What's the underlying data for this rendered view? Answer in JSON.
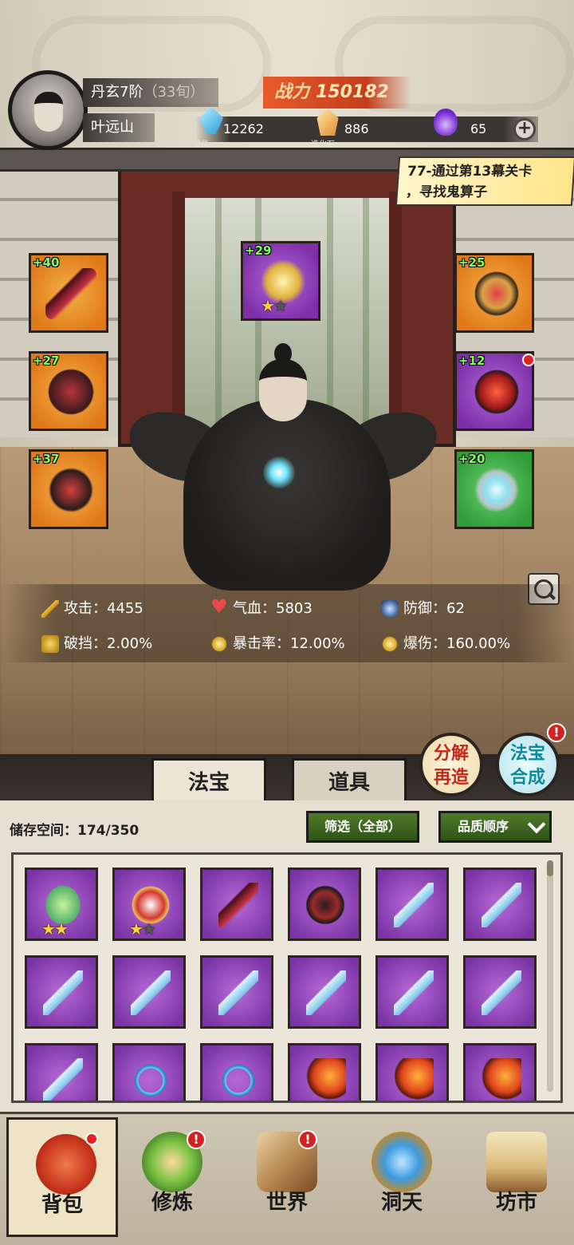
{
  "player": {
    "realm": "丹玄7阶",
    "age": "（33旬）",
    "name": "叶远山"
  },
  "power": {
    "label": "战力",
    "value": "150182"
  },
  "resources": [
    {
      "icon": "blue-crystal-icon",
      "caption": "灵晶",
      "value": "12262"
    },
    {
      "icon": "orange-stone-icon",
      "caption": "造化石",
      "value": "886"
    },
    {
      "icon": "purple-flame-icon",
      "caption": "",
      "value": "65"
    }
  ],
  "quest": {
    "line1": "77-通过第13幕关卡",
    "line2": "，寻找鬼算子"
  },
  "equipment": {
    "top": {
      "level": "+29",
      "stars_on": 1,
      "stars_total": 2
    },
    "left": [
      {
        "level": "+40"
      },
      {
        "level": "+27"
      },
      {
        "level": "+37"
      }
    ],
    "right": [
      {
        "level": "+25"
      },
      {
        "level": "+12"
      },
      {
        "level": "+20"
      }
    ]
  },
  "stats": {
    "attack": "攻击：4455",
    "hp": "气血：5803",
    "defense": "防御：62",
    "break": "破挡：2.00%",
    "crit_rate": "暴击率：12.00%",
    "crit_dmg": "爆伤：160.00%"
  },
  "round_buttons": {
    "fenjie": {
      "l1": "分解",
      "l2": "再造"
    },
    "hecheng": {
      "l1": "法宝",
      "l2": "合成",
      "badge": "!"
    }
  },
  "tabs": {
    "fabao": "法宝",
    "daoju": "道具"
  },
  "inventory": {
    "storage": "储存空间：174/350",
    "filter": "筛选（全部）",
    "sort": "品质顺序"
  },
  "nav": {
    "bag": "背包",
    "cultivate": "修炼",
    "world": "世界",
    "cave": "洞天",
    "market": "坊市",
    "badge": "!"
  },
  "colors": {
    "power_bg": "#e85a2a",
    "level_text": "#7cff5a",
    "filter_green": "#4f7a2a",
    "item_purple": "#7b34a6"
  }
}
